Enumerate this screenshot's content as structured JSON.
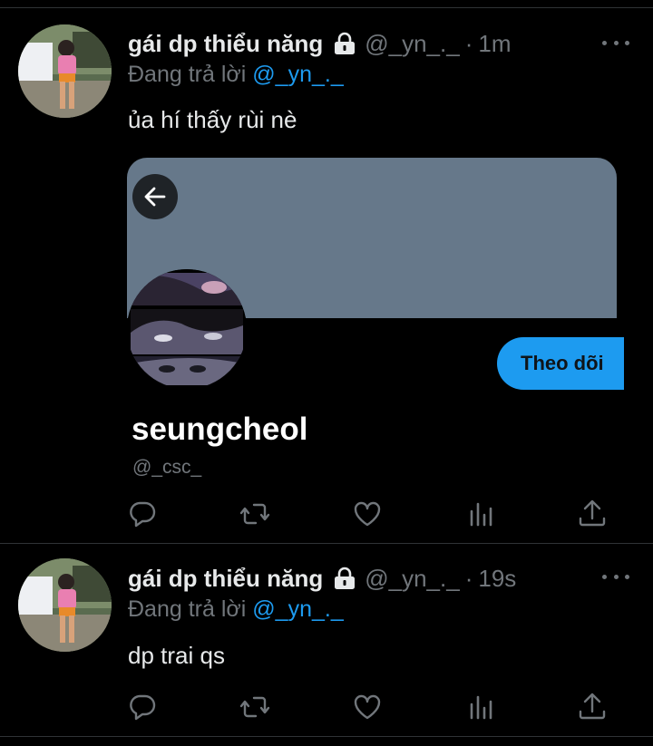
{
  "colors": {
    "background": "#000000",
    "accent": "#1d9bf0",
    "muted": "#71767b",
    "text": "#e7e9ea"
  },
  "tweets": [
    {
      "author_name": "gái dp thiểu năng",
      "author_handle": "@_yn_._",
      "separator": "·",
      "time": "1m",
      "reply_prefix": "Đang trả lời",
      "reply_to": "@_yn_._",
      "text": "ủa hí thấy rùi nè"
    },
    {
      "author_name": "gái dp thiểu năng",
      "author_handle": "@_yn_._",
      "separator": "·",
      "time": "19s",
      "reply_prefix": "Đang trả lời",
      "reply_to": "@_yn_._",
      "text": "dp trai qs"
    }
  ],
  "profile_card": {
    "display_name": "seungcheol",
    "handle": "@_csc_",
    "follow_label": "Theo dõi"
  },
  "icons": [
    "lock-icon",
    "more-icon",
    "back-arrow-icon",
    "reply-icon",
    "retweet-icon",
    "like-icon",
    "views-icon",
    "share-icon"
  ]
}
